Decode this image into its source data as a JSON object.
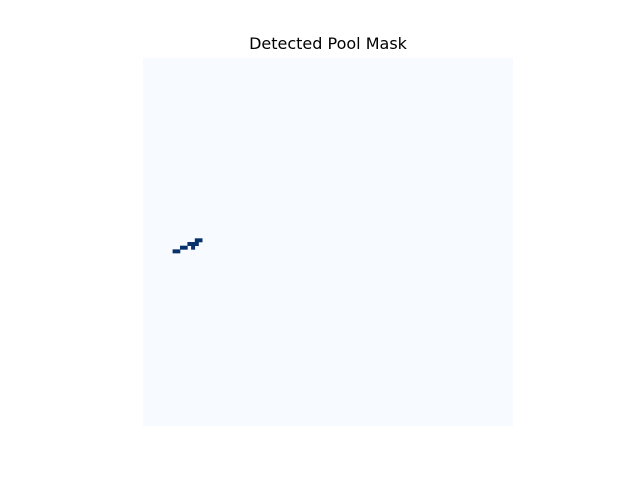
{
  "chart_data": {
    "type": "heatmap",
    "title": "Detected Pool Mask",
    "xlabel": "",
    "ylabel": "",
    "axes_visible": false,
    "colormap": "Blues",
    "background_value": 0,
    "grid_size": [
      100,
      100
    ],
    "value_range": [
      0,
      1
    ],
    "mask_regions": [
      {
        "label": "",
        "value": 1,
        "pixels": [
          [
            8,
            52
          ],
          [
            9,
            52
          ],
          [
            10,
            51
          ],
          [
            11,
            51
          ],
          [
            12,
            50
          ],
          [
            13,
            50
          ],
          [
            14,
            49
          ],
          [
            15,
            49
          ],
          [
            13,
            51
          ],
          [
            14,
            50
          ]
        ]
      }
    ],
    "colors": {
      "low": "#f7fbff",
      "high": "#08306b"
    }
  }
}
